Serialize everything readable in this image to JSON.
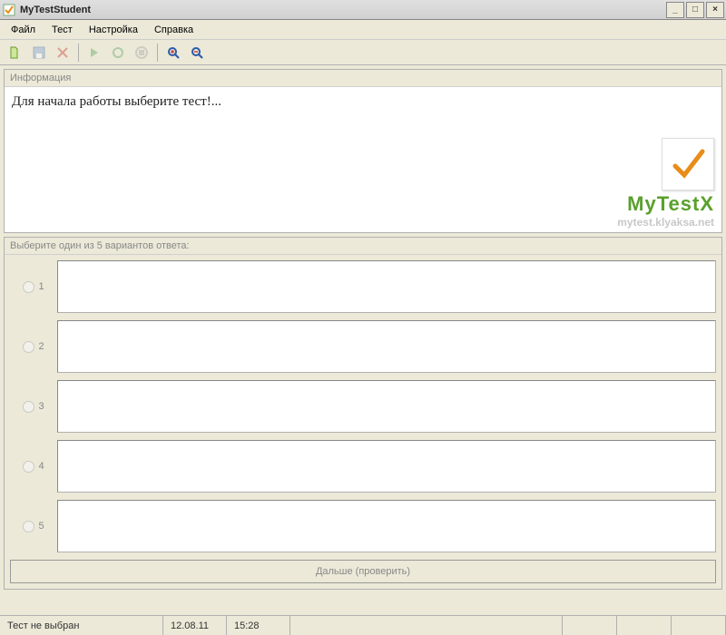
{
  "window": {
    "title": "MyTestStudent"
  },
  "menu": {
    "file": "Файл",
    "test": "Тест",
    "settings": "Настройка",
    "help": "Справка"
  },
  "info_panel": {
    "header": "Информация",
    "message": "Для начала работы выберите тест!..."
  },
  "logo": {
    "title": "MyTestX",
    "url": "mytest.klyaksa.net"
  },
  "answers_panel": {
    "header": "Выберите один из 5 вариантов ответа:",
    "options": [
      "1",
      "2",
      "3",
      "4",
      "5"
    ]
  },
  "next_button": "Дальше (проверить)",
  "status": {
    "message": "Тест не выбран",
    "date": "12.08.11",
    "time": "15:28"
  }
}
